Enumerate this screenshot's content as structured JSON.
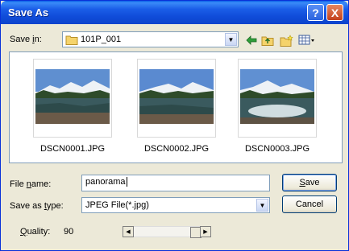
{
  "window": {
    "title": "Save As"
  },
  "title_buttons": {
    "help": "?",
    "close": "X"
  },
  "save_in": {
    "label_pre": "Save ",
    "label_u": "i",
    "label_post": "n:",
    "value": "101P_001"
  },
  "files": [
    {
      "name": "DSCN0001.JPG"
    },
    {
      "name": "DSCN0002.JPG"
    },
    {
      "name": "DSCN0003.JPG"
    }
  ],
  "file_name": {
    "label_pre": "File ",
    "label_u": "n",
    "label_post": "ame:",
    "value": "panorama"
  },
  "save_type": {
    "label_pre": "Save as ",
    "label_u": "t",
    "label_post": "ype:",
    "value": "JPEG File(*.jpg)"
  },
  "quality": {
    "label_u": "Q",
    "label_post": "uality:",
    "value": "90"
  },
  "buttons": {
    "save_u": "S",
    "save_post": "ave",
    "cancel": "Cancel"
  },
  "colors": {
    "titlebar": "#0c44cc",
    "sky": "#5f8fd0",
    "water": "#2d4a4a"
  }
}
